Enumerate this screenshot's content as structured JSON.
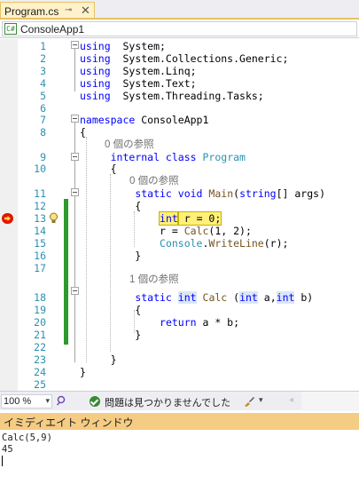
{
  "tab": {
    "title": "Program.cs",
    "pin": "⊸",
    "close": "✕"
  },
  "nav": {
    "icon_text": "C#",
    "project": "ConsoleApp1"
  },
  "lines": [
    {
      "n": "1",
      "segs": [
        [
          "kw",
          "using"
        ],
        [
          "",
          "  System;"
        ]
      ]
    },
    {
      "n": "2",
      "segs": [
        [
          "kw",
          "using"
        ],
        [
          "",
          "  System.Collections.Generic;"
        ]
      ]
    },
    {
      "n": "3",
      "segs": [
        [
          "kw",
          "using"
        ],
        [
          "",
          "  System.Linq;"
        ]
      ]
    },
    {
      "n": "4",
      "segs": [
        [
          "kw",
          "using"
        ],
        [
          "",
          "  System.Text;"
        ]
      ]
    },
    {
      "n": "5",
      "segs": [
        [
          "kw",
          "using"
        ],
        [
          "",
          "  System.Threading.Tasks;"
        ]
      ]
    },
    {
      "n": "6",
      "segs": []
    },
    {
      "n": "7",
      "segs": [
        [
          "kw",
          "namespace"
        ],
        [
          "",
          " ConsoleApp1"
        ]
      ]
    },
    {
      "n": "8",
      "segs": [
        [
          "",
          "{"
        ]
      ]
    },
    {
      "n": "9",
      "segs": [
        [
          "",
          "     "
        ],
        [
          "kw",
          "internal class"
        ],
        [
          "",
          " "
        ],
        [
          "ty",
          "Program"
        ]
      ]
    },
    {
      "n": "10",
      "segs": [
        [
          "",
          "     {"
        ]
      ]
    },
    {
      "n": "11",
      "segs": [
        [
          "",
          "         "
        ],
        [
          "kw",
          "static void"
        ],
        [
          "",
          " "
        ],
        [
          "fn",
          "Main"
        ],
        [
          "",
          "("
        ],
        [
          "kw",
          "string"
        ],
        [
          "",
          "[] args)"
        ]
      ]
    },
    {
      "n": "12",
      "segs": [
        [
          "",
          "         {"
        ]
      ]
    },
    {
      "n": "13",
      "segs": [
        [
          "",
          "             "
        ],
        [
          "hlkw",
          "int"
        ],
        [
          "hl",
          " r = 0;"
        ]
      ]
    },
    {
      "n": "14",
      "segs": [
        [
          "",
          "             r = "
        ],
        [
          "fn",
          "Calc"
        ],
        [
          "",
          "(1, 2);"
        ]
      ]
    },
    {
      "n": "15",
      "segs": [
        [
          "",
          "             "
        ],
        [
          "ty",
          "Console"
        ],
        [
          "",
          "."
        ],
        [
          "fn",
          "WriteLine"
        ],
        [
          "",
          "(r);"
        ]
      ]
    },
    {
      "n": "16",
      "segs": [
        [
          "",
          "         }"
        ]
      ]
    },
    {
      "n": "17",
      "segs": []
    },
    {
      "n": "18",
      "segs": [
        [
          "",
          "         "
        ],
        [
          "kw",
          "static"
        ],
        [
          "",
          " "
        ],
        [
          "kwb",
          "int"
        ],
        [
          "",
          " "
        ],
        [
          "fn",
          "Calc"
        ],
        [
          "",
          " ("
        ],
        [
          "kwb",
          "int"
        ],
        [
          "",
          " a,"
        ],
        [
          "kwb",
          "int"
        ],
        [
          "",
          " b)"
        ]
      ]
    },
    {
      "n": "19",
      "segs": [
        [
          "",
          "         {"
        ]
      ]
    },
    {
      "n": "20",
      "segs": [
        [
          "",
          "             "
        ],
        [
          "kw",
          "return"
        ],
        [
          "",
          " a * b;"
        ]
      ]
    },
    {
      "n": "21",
      "segs": [
        [
          "",
          "         }"
        ]
      ]
    },
    {
      "n": "22",
      "segs": []
    },
    {
      "n": "23",
      "segs": [
        [
          "",
          "     }"
        ]
      ]
    },
    {
      "n": "24",
      "segs": [
        [
          "",
          "}"
        ]
      ]
    },
    {
      "n": "25",
      "segs": []
    }
  ],
  "lens": [
    "0 個の参照",
    "0 個の参照",
    "1 個の参照"
  ],
  "status": {
    "zoom": "100 %",
    "zoom_arrow": "▾",
    "message": "問題は見つかりませんでした",
    "brush_arrow": "▾",
    "scroll_left": "◂"
  },
  "immediate": {
    "title": "イミディエイト ウィンドウ",
    "lines": [
      "Calc(5,9)",
      "45"
    ]
  },
  "colors": {
    "keyword": "#0000ff",
    "type": "#2b91af",
    "method": "#74531f",
    "change_bar": "#2e9a2e",
    "tab_active": "#fff1c9",
    "immediate_title": "#f5cc84"
  }
}
